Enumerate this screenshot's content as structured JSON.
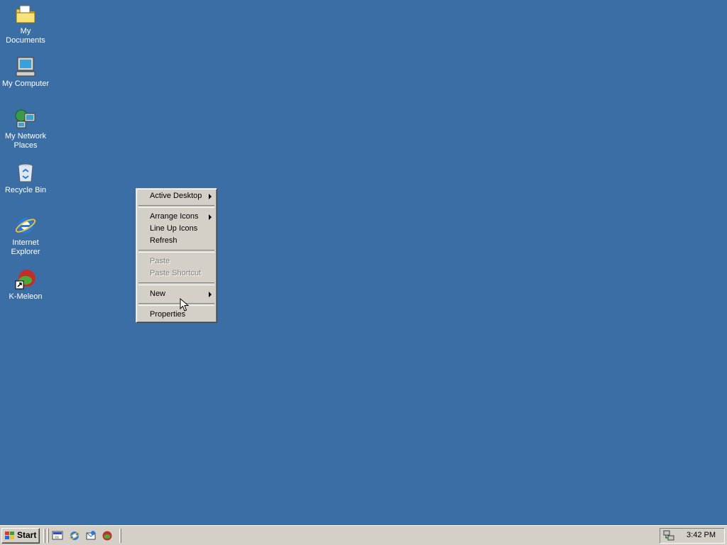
{
  "desktop": {
    "background": "#3a6ea5",
    "icons": [
      {
        "label": "My Documents",
        "icon": "folder-documents-icon"
      },
      {
        "label": "My Computer",
        "icon": "computer-icon"
      },
      {
        "label": "My Network\nPlaces",
        "icon": "network-places-icon"
      },
      {
        "label": "Recycle Bin",
        "icon": "recycle-bin-icon"
      },
      {
        "label": "Internet\nExplorer",
        "icon": "internet-explorer-icon"
      },
      {
        "label": "K-Meleon",
        "icon": "k-meleon-icon"
      }
    ]
  },
  "context_menu": {
    "items": [
      {
        "label": "Active Desktop",
        "submenu": true,
        "enabled": true
      },
      {
        "separator": true
      },
      {
        "label": "Arrange Icons",
        "submenu": true,
        "enabled": true
      },
      {
        "label": "Line Up Icons",
        "submenu": false,
        "enabled": true
      },
      {
        "label": "Refresh",
        "submenu": false,
        "enabled": true
      },
      {
        "separator": true
      },
      {
        "label": "Paste",
        "submenu": false,
        "enabled": false
      },
      {
        "label": "Paste Shortcut",
        "submenu": false,
        "enabled": false
      },
      {
        "separator": true
      },
      {
        "label": "New",
        "submenu": true,
        "enabled": true
      },
      {
        "separator": true
      },
      {
        "label": "Properties",
        "submenu": false,
        "enabled": true
      }
    ]
  },
  "taskbar": {
    "start_label": "Start",
    "quick_launch": [
      "show-desktop-icon",
      "internet-explorer-icon",
      "outlook-express-icon",
      "k-meleon-icon"
    ],
    "tray": {
      "clock": "3:42 PM",
      "icon": "network-tray-icon"
    }
  }
}
